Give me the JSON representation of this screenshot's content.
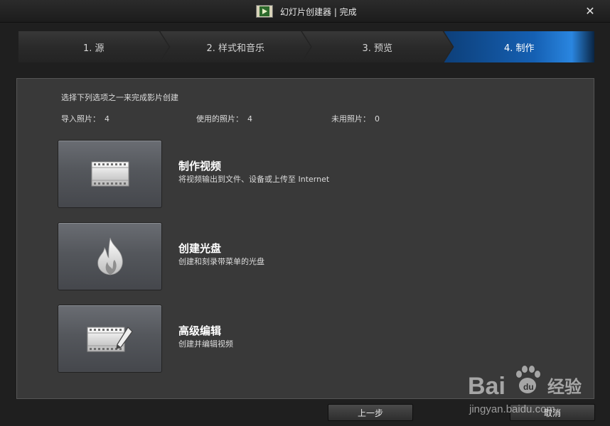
{
  "window": {
    "title": "幻灯片创建器 | 完成",
    "close_label": "✕"
  },
  "steps": [
    {
      "label": "1. 源",
      "active": false
    },
    {
      "label": "2. 样式和音乐",
      "active": false
    },
    {
      "label": "3. 预览",
      "active": false
    },
    {
      "label": "4. 制作",
      "active": true
    }
  ],
  "panel": {
    "instruction": "选择下列选项之一来完成影片创建",
    "stats": [
      {
        "label": "导入照片：",
        "value": "4"
      },
      {
        "label": "使用的照片：",
        "value": "4"
      },
      {
        "label": "未用照片：",
        "value": "0"
      }
    ],
    "actions": [
      {
        "title": "制作视频",
        "desc": "将视频输出到文件、设备或上传至 Internet",
        "icon": "film-strip-icon"
      },
      {
        "title": "创建光盘",
        "desc": "创建和刻录带菜单的光盘",
        "icon": "flame-icon"
      },
      {
        "title": "高级编辑",
        "desc": "创建并编辑视频",
        "icon": "film-edit-icon"
      }
    ]
  },
  "footer": {
    "back_label": "上一步",
    "cancel_label": "取消"
  },
  "watermark": {
    "brand": "Bai",
    "brand2": "经验",
    "url": "jingyan.baidu.com"
  },
  "colors": {
    "active_step": "#1560b3",
    "panel_bg": "#393939",
    "window_bg": "#1f1f1f"
  }
}
